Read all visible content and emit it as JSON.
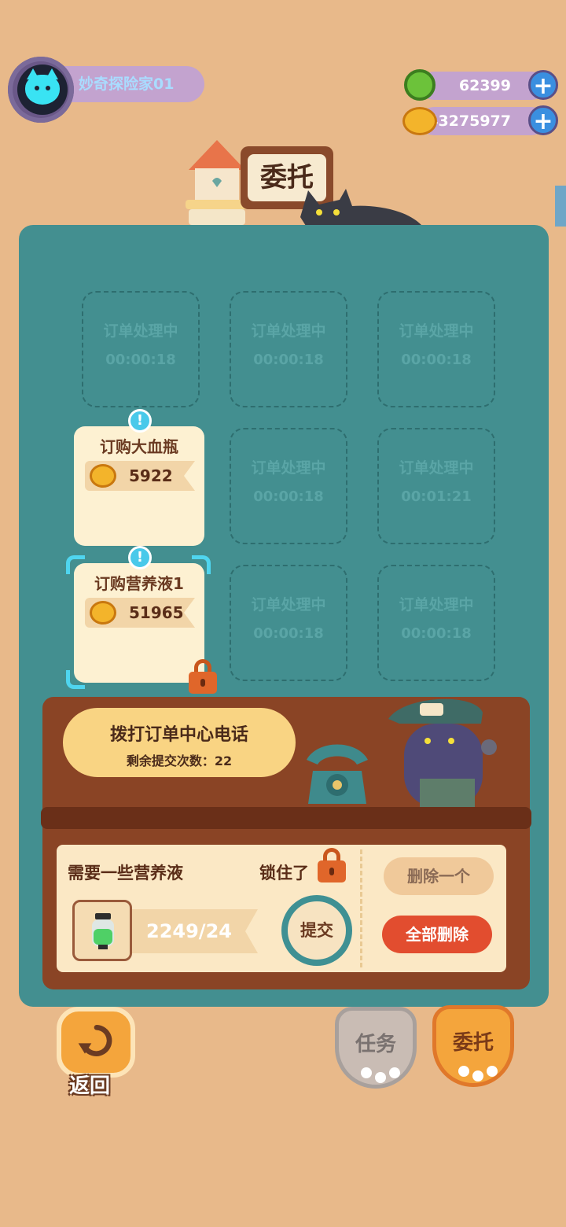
{
  "player": {
    "name": "妙奇探险家01"
  },
  "currencies": [
    {
      "icon": "green-gem-icon",
      "amount": "62399"
    },
    {
      "icon": "gold-coin-icon",
      "amount": "43275977"
    }
  ],
  "title": "委托",
  "order_slots": [
    {
      "status": "订单处理中",
      "timer": "00:00:18"
    },
    {
      "status": "订单处理中",
      "timer": "00:00:18"
    },
    {
      "status": "订单处理中",
      "timer": "00:00:18"
    },
    {
      "status": "订单处理中",
      "timer": "00:00:18"
    },
    {
      "status": "订单处理中",
      "timer": "00:01:21"
    },
    {
      "status": "订单处理中",
      "timer": "00:00:18"
    },
    {
      "status": "订单处理中",
      "timer": "00:00:18"
    }
  ],
  "order_cards": [
    {
      "title": "订购大血瓶",
      "price": "5922",
      "selected": false
    },
    {
      "title": "订购营养液1",
      "price": "51965",
      "selected": true
    }
  ],
  "hotline": {
    "title": "拨打订单中心电话",
    "remaining": "剩余提交次数：22"
  },
  "request": {
    "description": "需要一些营养液",
    "locked_label": "锁住了",
    "quantity": "2249/24",
    "submit_label": "提交"
  },
  "actions": {
    "delete_one": "删除一个",
    "delete_all": "全部删除"
  },
  "nav": {
    "back": "返回",
    "tasks": "任务",
    "commission": "委托"
  },
  "colors": {
    "background": "#e8b98a",
    "panel": "#438f90",
    "desk": "#8a4425",
    "delete_all": "#e24d2f"
  }
}
